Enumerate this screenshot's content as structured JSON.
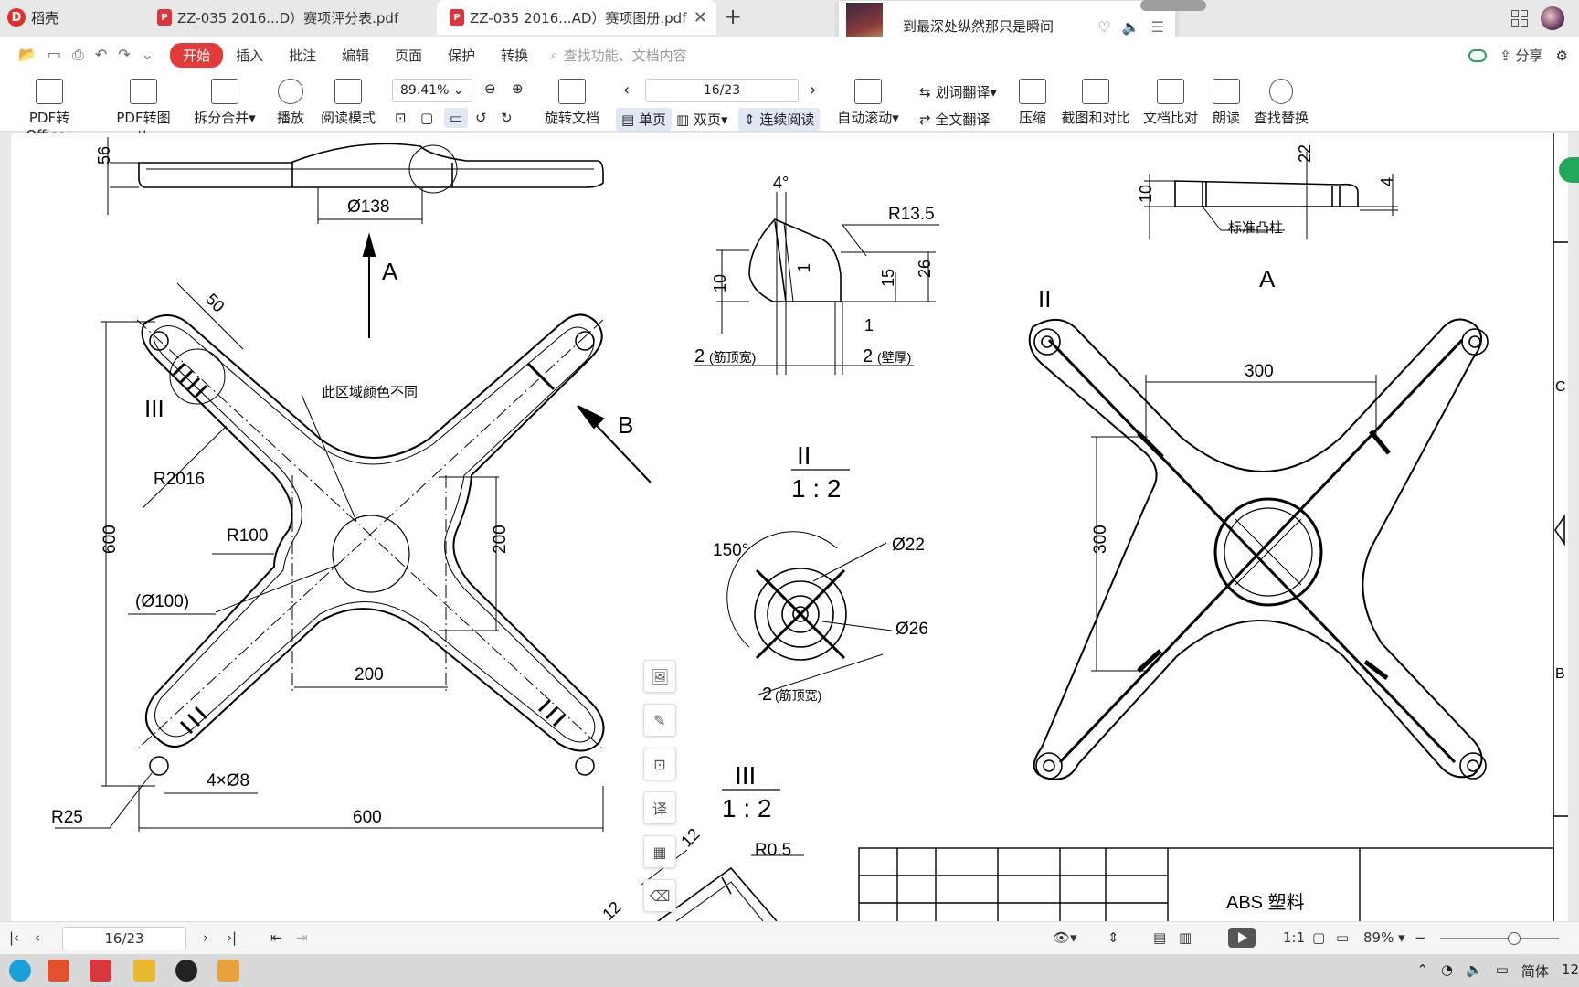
{
  "app": {
    "brand_label": "稻壳",
    "tabs": [
      {
        "label": "ZZ-035 2016...D）赛项评分表.pdf"
      },
      {
        "label": "ZZ-035 2016...AD）赛项图册.pdf"
      }
    ],
    "notification": {
      "text": "到最深处纵然那只是瞬间"
    }
  },
  "menu": {
    "items": [
      "开始",
      "插入",
      "批注",
      "编辑",
      "页面",
      "保护",
      "转换"
    ],
    "search_placeholder": "查找功能、文档内容",
    "share_label": "分享"
  },
  "ribbon": {
    "pdf_to_office": "PDF转Office",
    "pdf_to_image": "PDF转图片",
    "split_merge": "拆分合并",
    "play": "播放",
    "read_mode": "阅读模式",
    "zoom_value": "89.41%",
    "rotate": "旋转文档",
    "page_value": "16/23",
    "single_page": "单页",
    "double_page": "双页",
    "continuous": "连续阅读",
    "auto_scroll": "自动滚动",
    "word_translate": "划词翻译",
    "full_translate": "全文翻译",
    "compress": "压缩",
    "screenshot_compare": "截图和对比",
    "doc_compare": "文档比对",
    "read_aloud": "朗读",
    "find_replace": "查找替换"
  },
  "drawing": {
    "dims": {
      "d56": "56",
      "d138": "Ø138",
      "viewA": "A",
      "d50": "50",
      "labelIII": "III",
      "note_color": "此区域颜色不同",
      "viewB": "B",
      "r2016": "R2016",
      "r100": "R100",
      "d600v": "600",
      "d200v": "200",
      "d100": "(Ø100)",
      "d200h": "200",
      "d4x8": "4×Ø8",
      "r25": "R25",
      "d600h": "600",
      "angle4": "4°",
      "r135": "R13.5",
      "d10a": "10",
      "d1a": "1",
      "d15": "15",
      "d26": "26",
      "d1b": "1",
      "d2a": "2",
      "rib_top": "(筋顶宽)",
      "d2b": "2",
      "wall": "(壁厚)",
      "scaleII_label": "II",
      "scaleII": "1 : 2",
      "ang150": "150°",
      "d22": "Ø22",
      "d26b": "Ø26",
      "d2c": "2",
      "rib_top2": "(筋顶宽)",
      "scaleIII_label": "III",
      "scaleIII": "1 : 2",
      "d12": "12",
      "r05": "R0.5",
      "d12b": "12",
      "d22top": "22",
      "d10b": "10",
      "d4": "4",
      "boss": "标准凸柱",
      "viewA2": "A",
      "labelII": "II",
      "d300h": "300",
      "d300v": "300",
      "material": "ABS 塑料",
      "frame_C": "C",
      "frame_B": "B"
    }
  },
  "status": {
    "page_value": "16/23",
    "zoom_value": "89%"
  },
  "taskbar": {
    "ime": "简体",
    "clock": "12"
  }
}
